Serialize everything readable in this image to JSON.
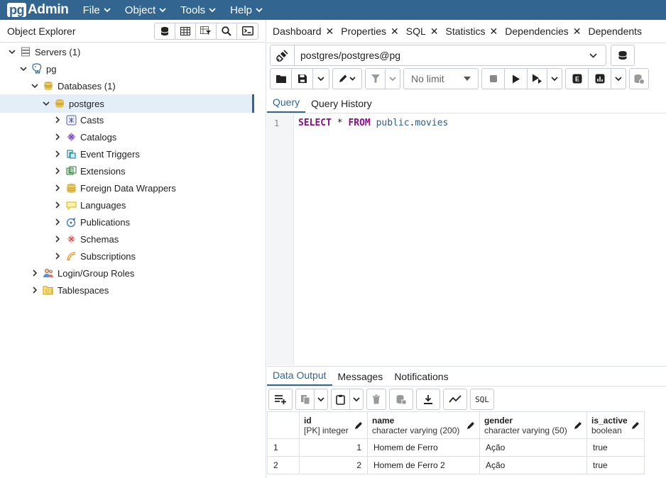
{
  "app": {
    "brand_pg": "pg",
    "brand_admin": "Admin"
  },
  "menu": [
    "File",
    "Object",
    "Tools",
    "Help"
  ],
  "explorer": {
    "title": "Object Explorer",
    "tree": [
      {
        "label": "Servers (1)",
        "level": 0,
        "icon": "servers-icon",
        "expanded": true
      },
      {
        "label": "pg",
        "level": 1,
        "icon": "elephant-icon",
        "expanded": true
      },
      {
        "label": "Databases (1)",
        "level": 2,
        "icon": "databases-icon",
        "expanded": true
      },
      {
        "label": "postgres",
        "level": 3,
        "icon": "database-icon",
        "expanded": true,
        "selected": true
      },
      {
        "label": "Casts",
        "level": 4,
        "icon": "casts-icon"
      },
      {
        "label": "Catalogs",
        "level": 4,
        "icon": "catalogs-icon"
      },
      {
        "label": "Event Triggers",
        "level": 4,
        "icon": "event-triggers-icon"
      },
      {
        "label": "Extensions",
        "level": 4,
        "icon": "extensions-icon"
      },
      {
        "label": "Foreign Data Wrappers",
        "level": 4,
        "icon": "fdw-icon"
      },
      {
        "label": "Languages",
        "level": 4,
        "icon": "languages-icon"
      },
      {
        "label": "Publications",
        "level": 4,
        "icon": "publications-icon"
      },
      {
        "label": "Schemas",
        "level": 4,
        "icon": "schemas-icon"
      },
      {
        "label": "Subscriptions",
        "level": 4,
        "icon": "subscriptions-icon"
      },
      {
        "label": "Login/Group Roles",
        "level": 2,
        "icon": "roles-icon"
      },
      {
        "label": "Tablespaces",
        "level": 2,
        "icon": "tablespaces-icon"
      }
    ]
  },
  "tabs": [
    "Dashboard",
    "Properties",
    "SQL",
    "Statistics",
    "Dependencies",
    "Dependents"
  ],
  "query_tool": {
    "connection": "postgres/postgres@pg",
    "limit": "No limit",
    "subtabs": [
      "Query",
      "Query History"
    ],
    "line_number": "1",
    "sql": {
      "kw1": "SELECT",
      "star": "*",
      "kw2": "FROM",
      "schema": "public",
      "dot": ".",
      "table": "movies"
    }
  },
  "output": {
    "subtabs": [
      "Data Output",
      "Messages",
      "Notifications"
    ],
    "sql_button": "SQL",
    "columns": [
      {
        "name": "id",
        "type": "[PK] integer"
      },
      {
        "name": "name",
        "type": "character varying (200)"
      },
      {
        "name": "gender",
        "type": "character varying (50)"
      },
      {
        "name": "is_active",
        "type": "boolean"
      }
    ],
    "rows": [
      {
        "n": "1",
        "id": "1",
        "name": "Homem de Ferro",
        "gender": "Ação",
        "is_active": "true"
      },
      {
        "n": "2",
        "id": "2",
        "name": "Homem de Ferro 2",
        "gender": "Ação",
        "is_active": "true"
      }
    ]
  },
  "colors": {
    "navbar": "#326690",
    "selected_bg": "#e4eef8",
    "keyword": "#8d0a8d"
  }
}
